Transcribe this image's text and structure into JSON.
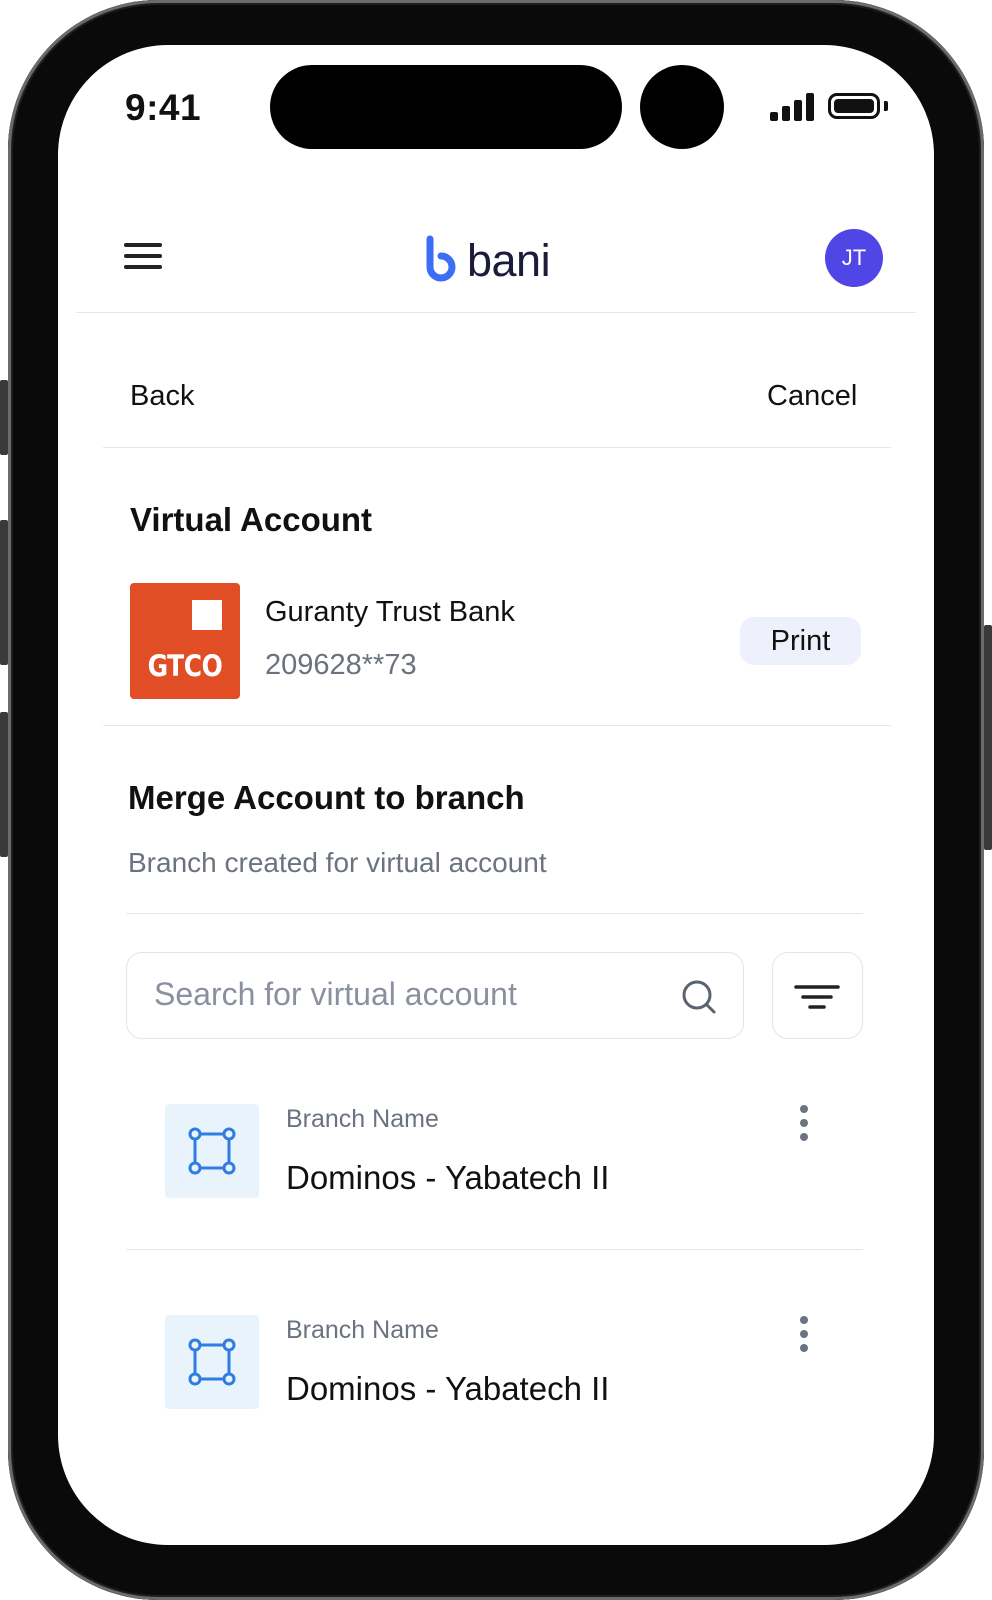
{
  "status_bar": {
    "time": "9:41"
  },
  "header": {
    "logo_text": "bani",
    "avatar_initials": "JT"
  },
  "nav": {
    "back_label": "Back",
    "cancel_label": "Cancel"
  },
  "virtual_account": {
    "section_title": "Virtual Account",
    "bank_logo_text": "GTCO",
    "bank_name": "Guranty Trust Bank",
    "account_number": "209628**73",
    "print_label": "Print"
  },
  "merge": {
    "title": "Merge Account to branch",
    "subtitle": "Branch created for virtual account",
    "search_placeholder": "Search for virtual account"
  },
  "branches": [
    {
      "label": "Branch Name",
      "value": "Dominos - Yabatech II"
    },
    {
      "label": "Branch Name",
      "value": "Dominos - Yabatech II"
    }
  ],
  "colors": {
    "brand_blue": "#3b6ef5",
    "avatar": "#4f46e5",
    "bank_logo": "#e14e26",
    "print_button_bg": "#eef0fb",
    "branch_icon_bg": "#e8f3fc",
    "branch_icon": "#2f7de1"
  }
}
